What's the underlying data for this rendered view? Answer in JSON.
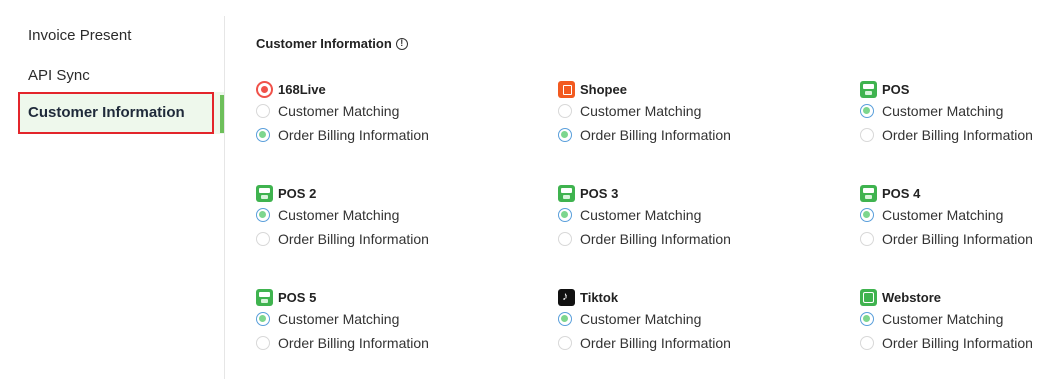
{
  "sidebar": {
    "items": [
      {
        "label": "Invoice Present"
      },
      {
        "label": "API Sync"
      },
      {
        "label": "Customer Information"
      }
    ]
  },
  "main": {
    "section_title": "Customer Information",
    "option_labels": {
      "matching": "Customer Matching",
      "billing": "Order Billing Information"
    },
    "channels": [
      {
        "name": "168Live",
        "icon": "168live-logo-icon",
        "selected": "billing"
      },
      {
        "name": "Shopee",
        "icon": "shopee-logo-icon",
        "selected": "billing"
      },
      {
        "name": "POS",
        "icon": "pos-logo-icon",
        "selected": "matching"
      },
      {
        "name": "POS 2",
        "icon": "pos-logo-icon",
        "selected": "matching"
      },
      {
        "name": "POS 3",
        "icon": "pos-logo-icon",
        "selected": "matching"
      },
      {
        "name": "POS 4",
        "icon": "pos-logo-icon",
        "selected": "matching"
      },
      {
        "name": "POS 5",
        "icon": "pos-logo-icon",
        "selected": "matching"
      },
      {
        "name": "Tiktok",
        "icon": "tiktok-logo-icon",
        "selected": "matching"
      },
      {
        "name": "Webstore",
        "icon": "webstore-logo-icon",
        "selected": "matching"
      }
    ]
  },
  "colors": {
    "active_border": "#e3252b",
    "active_bar": "#6dbf5a",
    "radio_dot": "#7dd68e",
    "radio_ring": "#5a9fdb"
  }
}
